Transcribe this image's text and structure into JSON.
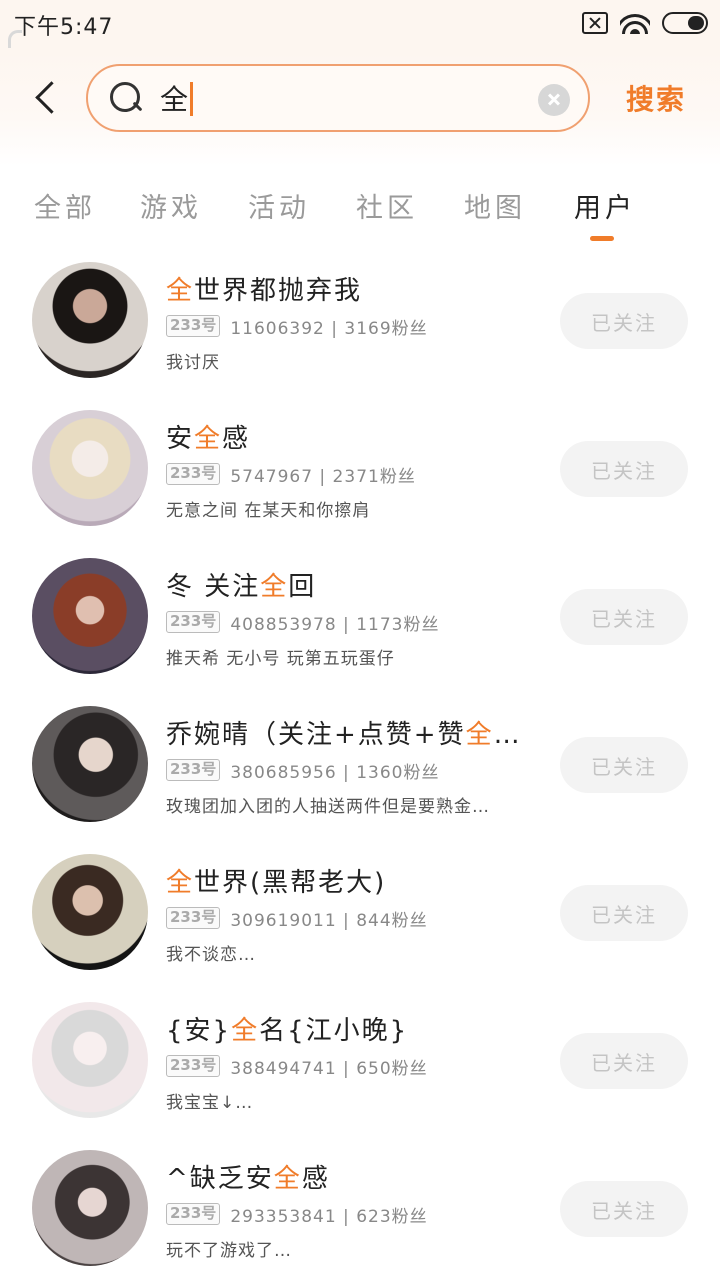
{
  "status_bar": {
    "time": "下午5:47"
  },
  "search": {
    "query": "全",
    "submit_label": "搜索"
  },
  "tabs": [
    {
      "label": "全部",
      "active": false
    },
    {
      "label": "游戏",
      "active": false
    },
    {
      "label": "活动",
      "active": false
    },
    {
      "label": "社区",
      "active": false
    },
    {
      "label": "地图",
      "active": false
    },
    {
      "label": "用户",
      "active": true
    }
  ],
  "colors": {
    "accent": "#f07c2a",
    "muted": "#9a9a9a"
  },
  "users": [
    {
      "name_pre": "",
      "name_hl": "全",
      "name_post": "世界都抛弃我",
      "id_tag": "233号",
      "stats": "11606392 | 3169粉丝",
      "bio": "我讨厌",
      "button": "已关注"
    },
    {
      "name_pre": "安",
      "name_hl": "全",
      "name_post": "感",
      "id_tag": "233号",
      "stats": "5747967 | 2371粉丝",
      "bio": "无意之间 在某天和你擦肩",
      "button": "已关注"
    },
    {
      "name_pre": "冬 关注",
      "name_hl": "全",
      "name_post": "回",
      "id_tag": "233号",
      "stats": "408853978 | 1173粉丝",
      "bio": "推天希 无小号 玩第五玩蛋仔",
      "button": "已关注"
    },
    {
      "name_pre": "乔婉晴（关注+点赞+赞",
      "name_hl": "全",
      "name_post": "…",
      "id_tag": "233号",
      "stats": "380685956 | 1360粉丝",
      "bio": "玫瑰团加入团的人抽送两件但是要熟金…",
      "button": "已关注"
    },
    {
      "name_pre": "",
      "name_hl": "全",
      "name_post": "世界(黑帮老大)",
      "id_tag": "233号",
      "stats": "309619011 | 844粉丝",
      "bio": "我不谈恋…",
      "button": "已关注"
    },
    {
      "name_pre": "{安}",
      "name_hl": "全",
      "name_post": "名{江小晚}",
      "id_tag": "233号",
      "stats": "388494741 | 650粉丝",
      "bio": "我宝宝↓…",
      "button": "已关注"
    },
    {
      "name_pre": "^缺乏安",
      "name_hl": "全",
      "name_post": "感",
      "id_tag": "233号",
      "stats": "293353841 | 623粉丝",
      "bio": "玩不了游戏了…",
      "button": "已关注"
    }
  ]
}
